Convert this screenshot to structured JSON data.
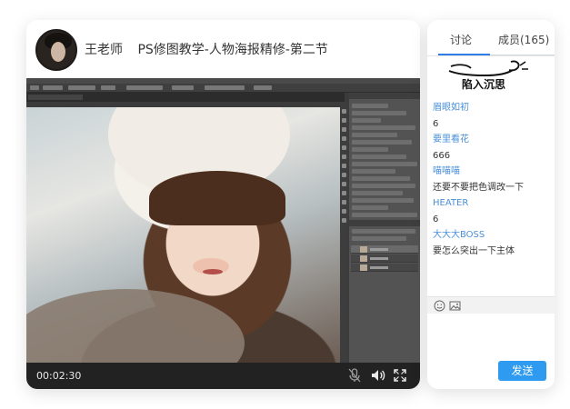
{
  "video": {
    "teacher_name": "王老师",
    "course_title": "PS修图教学-人物海报精修-第二节",
    "current_time": "00:02:30"
  },
  "icons": {
    "mic": "mic-muted-icon",
    "volume": "volume-icon",
    "fullscreen": "fullscreen-icon",
    "emoji": "emoji-icon",
    "image": "image-icon"
  },
  "chat": {
    "tabs": [
      {
        "label": "讨论"
      },
      {
        "label": "成员(165)"
      }
    ],
    "sticker_caption": "陷入沉思",
    "messages": [
      {
        "user": "眉眼如初",
        "text": "6"
      },
      {
        "user": "要里看花",
        "text": "666"
      },
      {
        "user": "喵喵喵",
        "text": "还要不要把色调改一下"
      },
      {
        "user": "HEATER",
        "text": "6"
      },
      {
        "user": "大大大BOSS",
        "text": "要怎么突出一下主体"
      }
    ],
    "send_label": "发送"
  },
  "colors": {
    "accent": "#2e9bf0",
    "username": "#4a90d9",
    "video_bar": "#222222"
  }
}
